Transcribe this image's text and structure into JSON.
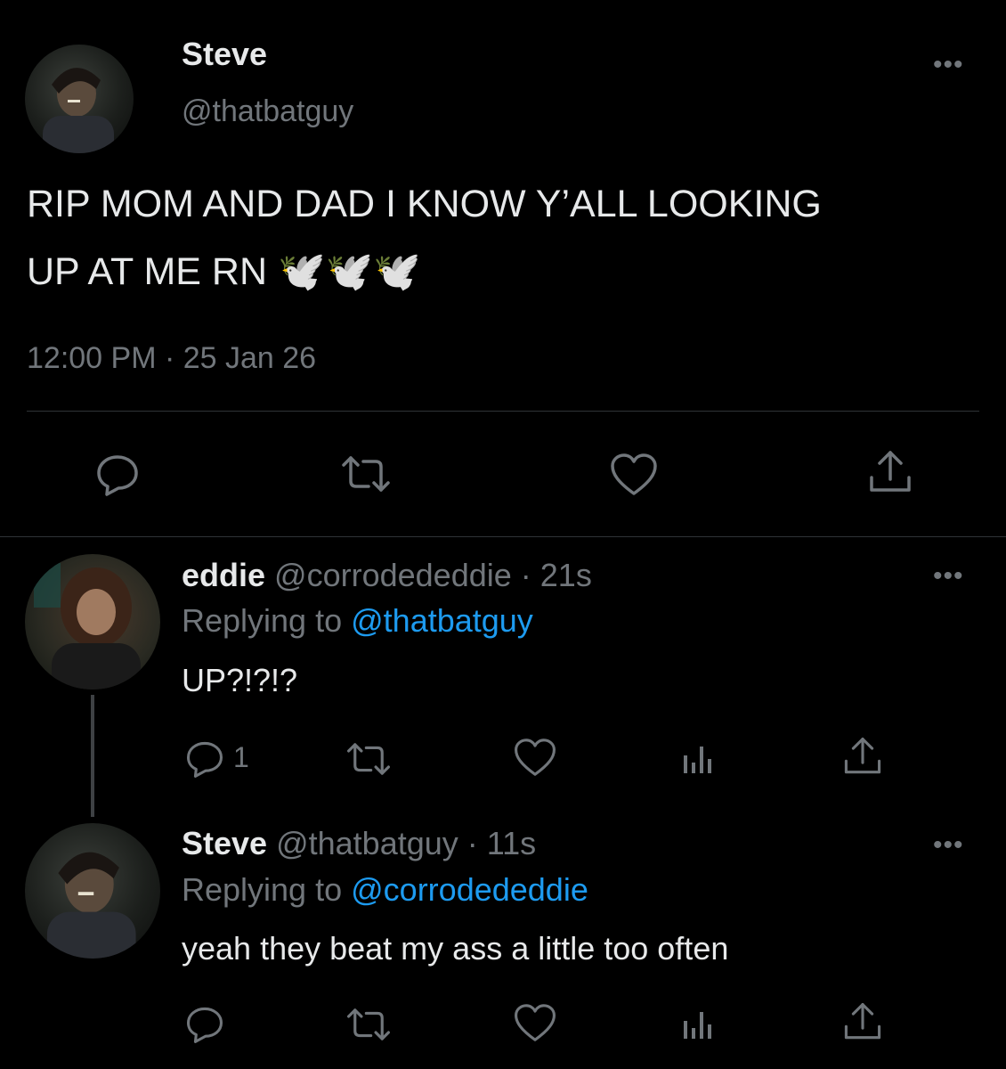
{
  "main_tweet": {
    "display_name": "Steve",
    "handle": "@thatbatguy",
    "text_line1": "RIP MOM AND DAD I KNOW Y’ALL LOOKING",
    "text_line2": "UP AT ME RN 🕊️🕊️🕊️",
    "timestamp": "12:00 PM · 25 Jan 26",
    "more": "•••"
  },
  "replies": [
    {
      "display_name": "eddie",
      "handle": "@corrodededdie",
      "time": "· 21s",
      "replying_prefix": "Replying to",
      "replying_to": "@thatbatguy",
      "text": "UP?!?!?",
      "reply_count": "1",
      "more": "•••"
    },
    {
      "display_name": "Steve",
      "handle": "@thatbatguy",
      "time": "· 11s",
      "replying_prefix": "Replying to",
      "replying_to": "@corrodededdie",
      "text": "yeah they beat my ass a little too often",
      "more": "•••"
    }
  ],
  "colors": {
    "background": "#000000",
    "text": "#e7e9ea",
    "muted": "#71767b",
    "link": "#1d9bf0",
    "divider": "#2f3336"
  },
  "icons": [
    "reply-icon",
    "retweet-icon",
    "like-icon",
    "views-icon",
    "share-icon",
    "more-icon"
  ]
}
